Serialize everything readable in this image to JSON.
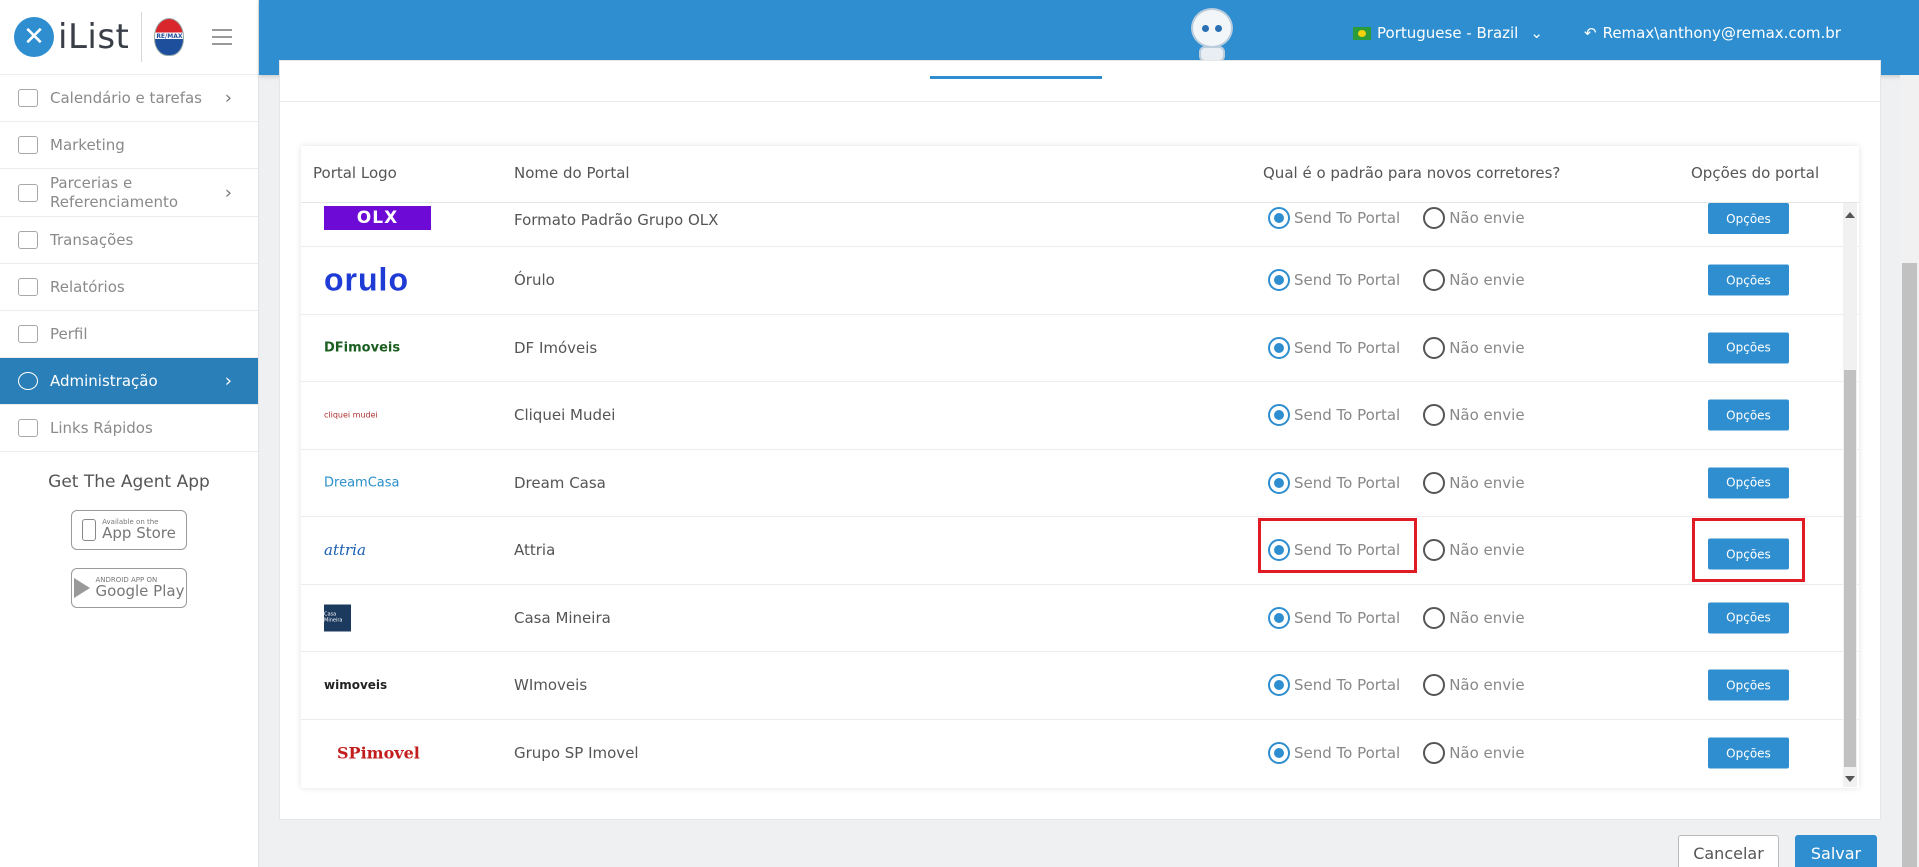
{
  "app": {
    "logo_text": "iList",
    "remax_label": "RE/MAX"
  },
  "sidebar": {
    "items": [
      {
        "label": "Calendário e tarefas",
        "chevron": true
      },
      {
        "label": "Marketing",
        "chevron": false
      },
      {
        "label": "Parcerias e Referenciamento",
        "chevron": true
      },
      {
        "label": "Transações",
        "chevron": false
      },
      {
        "label": "Relatórios",
        "chevron": false
      },
      {
        "label": "Perfil",
        "chevron": false
      },
      {
        "label": "Administração",
        "chevron": true,
        "active": true
      },
      {
        "label": "Links Rápidos",
        "chevron": false
      }
    ],
    "agent_app_title": "Get The Agent App",
    "app_store": {
      "small": "Available on the",
      "big": "App Store"
    },
    "google_play": {
      "small": "ANDROID APP ON",
      "big": "Google Play"
    }
  },
  "topbar": {
    "language": "Portuguese - Brazil",
    "user": "Remax\\anthony@remax.com.br"
  },
  "table": {
    "headers": {
      "logo": "Portal Logo",
      "name": "Nome do Portal",
      "default": "Qual é o padrão para novos corretores?",
      "options": "Opções do portal"
    },
    "radio_send": "Send To Portal",
    "radio_no": "Não envie",
    "options_button": "Opções",
    "rows": [
      {
        "name": "Formato Padrão Grupo OLX",
        "logo": "OLX",
        "send": true
      },
      {
        "name": "Órulo",
        "logo": "orulo",
        "send": true
      },
      {
        "name": "DF Imóveis",
        "logo": "DFimoveis",
        "send": true
      },
      {
        "name": "Cliquei Mudei",
        "logo": "cliquei mudei",
        "send": true
      },
      {
        "name": "Dream Casa",
        "logo": "DreamCasa",
        "send": true
      },
      {
        "name": "Attria",
        "logo": "attria",
        "send": true
      },
      {
        "name": "Casa Mineira",
        "logo": "Casa Mineira",
        "send": true
      },
      {
        "name": "WImoveis",
        "logo": "wimoveis",
        "send": true
      },
      {
        "name": "Grupo SP Imovel",
        "logo": "SPimovel",
        "send": true
      }
    ]
  },
  "footer": {
    "cancel": "Cancelar",
    "save": "Salvar"
  },
  "colors": {
    "primary": "#2f8ecf",
    "highlight": "#e01b24",
    "active_nav": "#2b7fb8"
  }
}
